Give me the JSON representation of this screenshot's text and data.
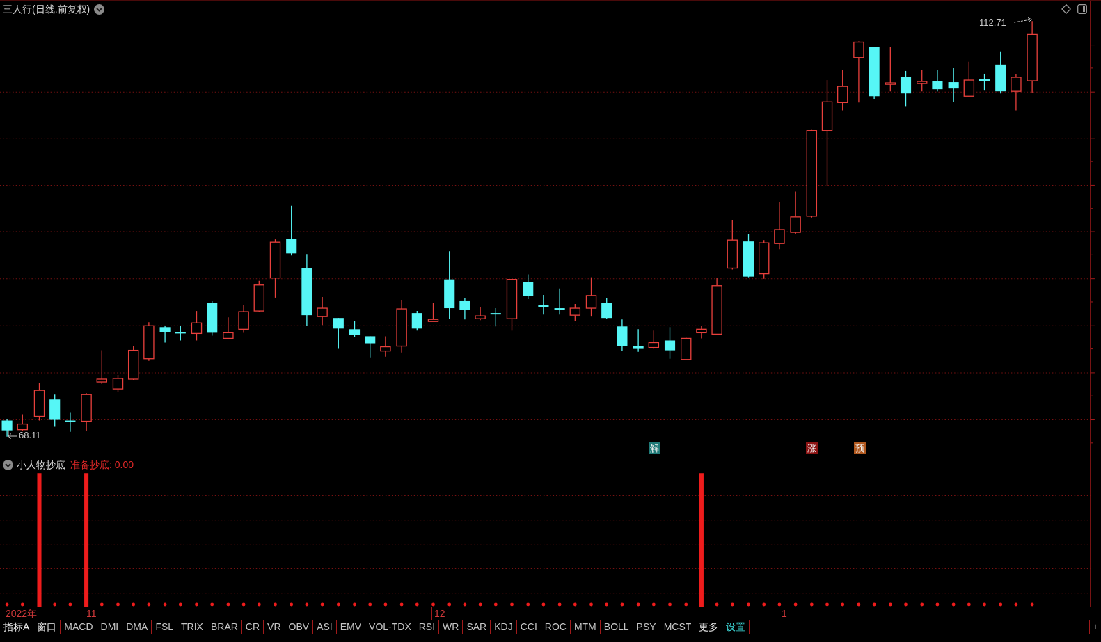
{
  "main_chart": {
    "title": "三人行(日线.前复权)",
    "high_label": "112.71",
    "low_label": "68.11",
    "signals": [
      {
        "text": "解",
        "color": "#1f7a78"
      },
      {
        "text": "涨",
        "color": "#8c1414"
      },
      {
        "text": "预",
        "color": "#b0581e"
      }
    ]
  },
  "indicator_panel": {
    "name": "小人物抄底",
    "value_label": "准备抄底: 0.00"
  },
  "date_axis": [
    {
      "label": "2022年"
    },
    {
      "label": "11"
    },
    {
      "label": "12"
    },
    {
      "label": "1"
    }
  ],
  "tabs": [
    {
      "label": "指标A",
      "kind": "menu"
    },
    {
      "label": "窗口",
      "kind": "menu"
    },
    {
      "label": "MACD",
      "kind": "indicator"
    },
    {
      "label": "DMI",
      "kind": "indicator"
    },
    {
      "label": "DMA",
      "kind": "indicator"
    },
    {
      "label": "FSL",
      "kind": "indicator"
    },
    {
      "label": "TRIX",
      "kind": "indicator"
    },
    {
      "label": "BRAR",
      "kind": "indicator"
    },
    {
      "label": "CR",
      "kind": "indicator"
    },
    {
      "label": "VR",
      "kind": "indicator"
    },
    {
      "label": "OBV",
      "kind": "indicator"
    },
    {
      "label": "ASI",
      "kind": "indicator"
    },
    {
      "label": "EMV",
      "kind": "indicator"
    },
    {
      "label": "VOL-TDX",
      "kind": "indicator"
    },
    {
      "label": "RSI",
      "kind": "indicator"
    },
    {
      "label": "WR",
      "kind": "indicator"
    },
    {
      "label": "SAR",
      "kind": "indicator"
    },
    {
      "label": "KDJ",
      "kind": "indicator"
    },
    {
      "label": "CCI",
      "kind": "indicator"
    },
    {
      "label": "ROC",
      "kind": "indicator"
    },
    {
      "label": "MTM",
      "kind": "indicator"
    },
    {
      "label": "BOLL",
      "kind": "indicator"
    },
    {
      "label": "PSY",
      "kind": "indicator"
    },
    {
      "label": "MCST",
      "kind": "indicator"
    },
    {
      "label": "更多",
      "kind": "menu"
    },
    {
      "label": "设置",
      "kind": "settings"
    }
  ],
  "add_button": "+"
}
